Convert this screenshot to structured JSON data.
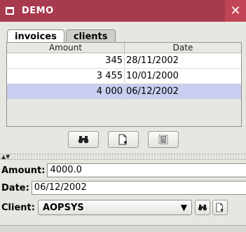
{
  "window": {
    "title": "DEMO",
    "close_label": "✕"
  },
  "tabs": [
    {
      "label": "invoices",
      "active": true
    },
    {
      "label": "clients",
      "active": false
    }
  ],
  "table": {
    "columns": [
      "Amount",
      "Date"
    ],
    "rows": [
      {
        "amount": "345",
        "date": "28/11/2002",
        "selected": false
      },
      {
        "amount": "3 455",
        "date": "10/01/2000",
        "selected": false
      },
      {
        "amount": "4 000",
        "date": "06/12/2002",
        "selected": true
      }
    ]
  },
  "toolbar": {
    "buttons": [
      {
        "icon": "binoculars-icon",
        "glyph": "👓"
      },
      {
        "icon": "new-document-icon",
        "glyph": "🗋"
      },
      {
        "icon": "trash-icon",
        "glyph": "🗑"
      }
    ]
  },
  "divider": {
    "arrows": "▲▼"
  },
  "form": {
    "amount_label": "Amount:",
    "amount_value": "4000.0",
    "date_label": "Date:",
    "date_value": "06/12/2002",
    "client_label": "Client:",
    "client_value": "AOPSYS"
  },
  "colors": {
    "titlebar": "#a83a4e",
    "selected_row": "#c9cdef",
    "panel": "#e7e7e2"
  }
}
